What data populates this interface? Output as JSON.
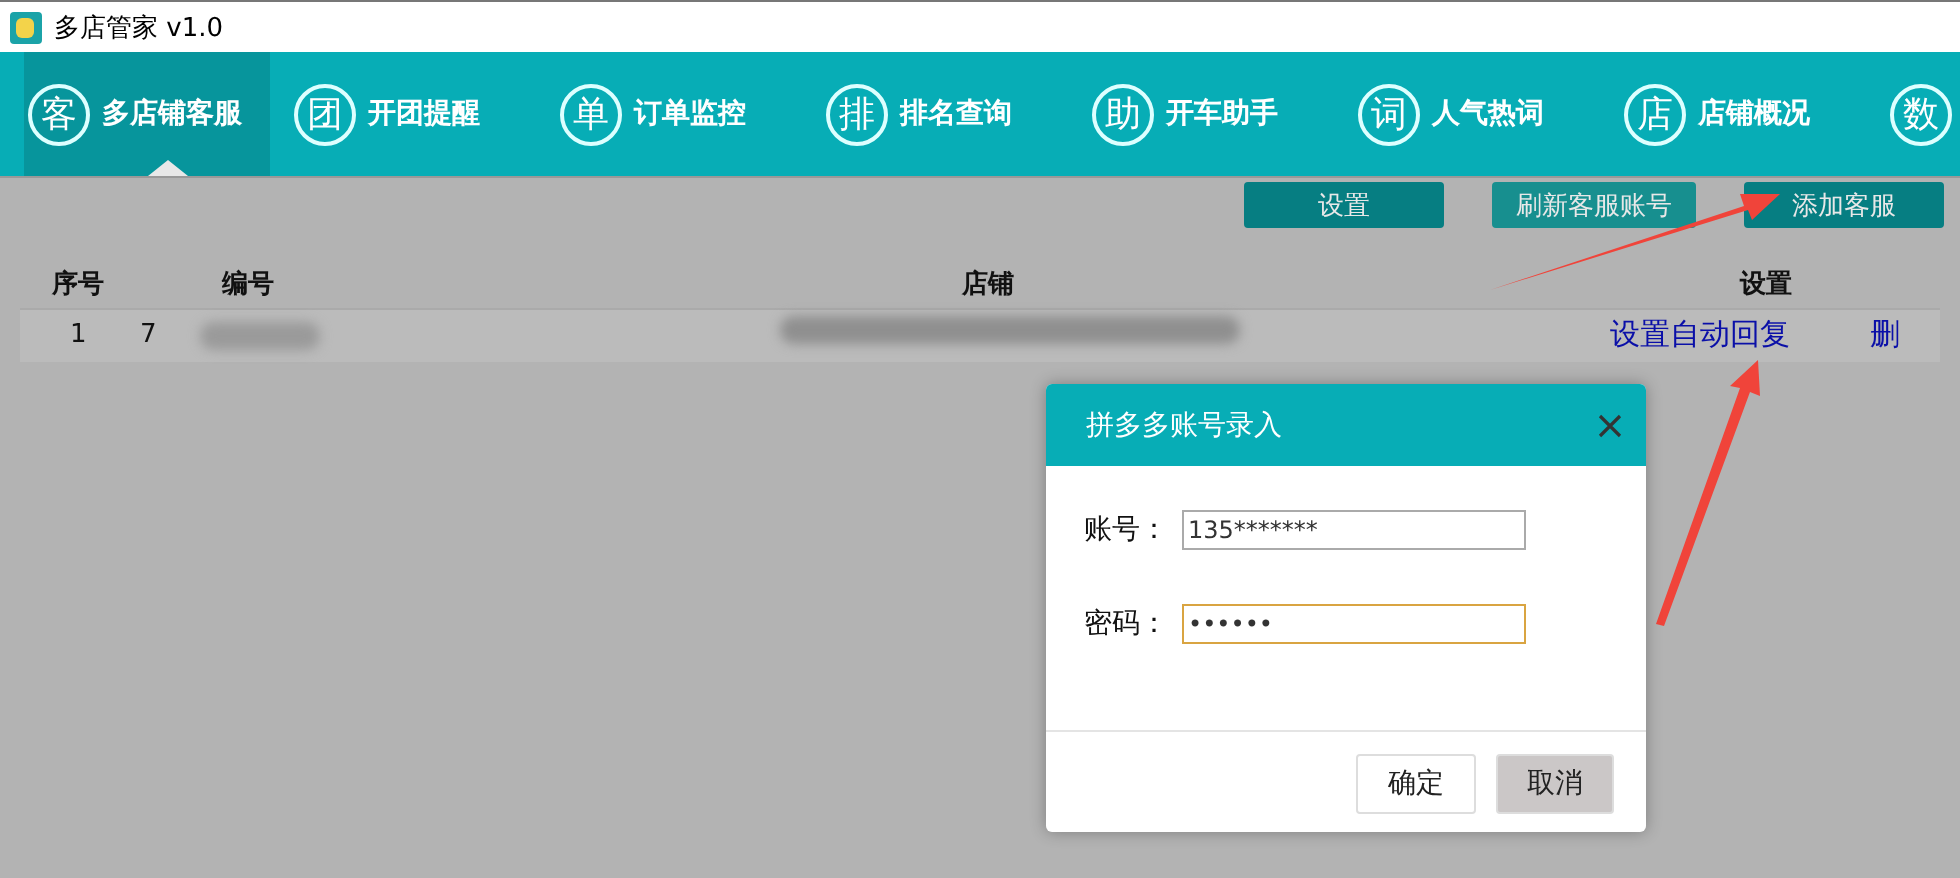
{
  "window": {
    "title": "多店管家 v1.0"
  },
  "tabs": [
    {
      "icon": "客",
      "label": "多店铺客服",
      "selected": true
    },
    {
      "icon": "团",
      "label": "开团提醒",
      "selected": false
    },
    {
      "icon": "单",
      "label": "订单监控",
      "selected": false
    },
    {
      "icon": "排",
      "label": "排名查询",
      "selected": false
    },
    {
      "icon": "助",
      "label": "开车助手",
      "selected": false
    },
    {
      "icon": "词",
      "label": "人气热词",
      "selected": false
    },
    {
      "icon": "店",
      "label": "店铺概况",
      "selected": false
    },
    {
      "icon": "数",
      "selected": false
    }
  ],
  "toolbar": {
    "buttons": [
      "设置",
      "刷新客服账号",
      "添加客服"
    ]
  },
  "table": {
    "columns": [
      "序号",
      "编号",
      "店铺",
      "设置"
    ],
    "rows": [
      {
        "index": "1",
        "number": "7",
        "actions": [
          "设置自动回复",
          "删"
        ]
      }
    ]
  },
  "dialog": {
    "title": "拼多多账号录入",
    "fields": [
      {
        "label": "账号：",
        "value": "135*******",
        "focused": false
      },
      {
        "label": "密码：",
        "value": "••••••",
        "focused": true
      }
    ],
    "buttons": [
      {
        "label": "确定",
        "kind": "primary"
      },
      {
        "label": "取消",
        "kind": "cancel"
      }
    ]
  }
}
